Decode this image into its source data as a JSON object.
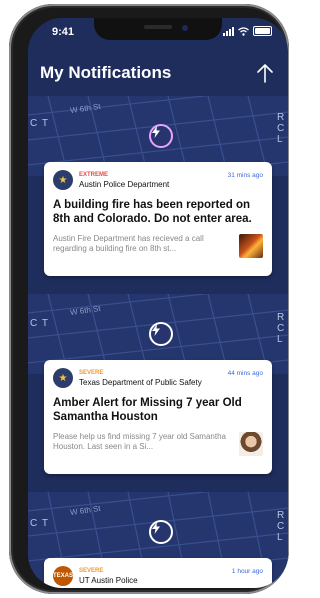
{
  "status_bar": {
    "time": "9:41"
  },
  "header": {
    "title": "My Notifications",
    "share_icon": "share-up-icon"
  },
  "map": {
    "street_label": "W 6th St",
    "left_edge": "C T",
    "right_edge": "R C L"
  },
  "notifications": [
    {
      "severity": "EXTREME",
      "severity_color": "#e34b4b",
      "agency": "Austin Police Department",
      "time": "31 mins ago",
      "title": "A building fire has been reported on 8th and Colorado. Do not enter area.",
      "body": "Austin Fire Department has recieved a call regarding a building fire on 8th st...",
      "thumbnail": "fire-photo"
    },
    {
      "severity": "SEVERE",
      "severity_color": "#f39a2b",
      "agency": "Texas Department of Public Safety",
      "time": "44 mins ago",
      "title": "Amber Alert for Missing 7 year Old Samantha Houston",
      "body": "Please help us find missing 7 year old Samantha Houston. Last seen in a Si...",
      "thumbnail": "missing-child-photo"
    },
    {
      "severity": "SEVERE",
      "severity_color": "#f39a2b",
      "agency": "UT Austin Police",
      "time": "1 hour ago",
      "avatar_text": "TEXAS"
    }
  ]
}
